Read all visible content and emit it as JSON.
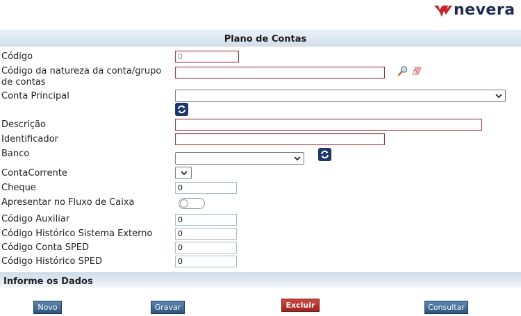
{
  "logo": {
    "text": "nevera",
    "brand_color": "#c8232a",
    "text_color": "#1d2a57"
  },
  "header": {
    "title": "Plano de Contas"
  },
  "form": {
    "codigo": {
      "label": "Código",
      "value": "0"
    },
    "natureza": {
      "label_line1": "Código da natureza da conta/grupo",
      "label_line2": "de contas",
      "value": "",
      "search_icon": "magnifier-icon",
      "clear_icon": "eraser-icon"
    },
    "conta_principal": {
      "label": "Conta Principal",
      "value": ""
    },
    "descricao": {
      "label": "Descrição",
      "value": ""
    },
    "identificador": {
      "label": "Identificador",
      "value": ""
    },
    "banco": {
      "label": "Banco",
      "value": ""
    },
    "conta_corrente": {
      "label": "ContaCorrente",
      "value": ""
    },
    "cheque": {
      "label": "Cheque",
      "value": "0"
    },
    "fluxo_caixa": {
      "label": "Apresentar no Fluxo de Caixa",
      "checked": false
    },
    "codigo_auxiliar": {
      "label": "Código Auxiliar",
      "value": "0"
    },
    "historico_externo": {
      "label": "Código Histórico Sistema Externo",
      "value": "0"
    },
    "conta_sped": {
      "label": "Código Conta SPED",
      "value": "0"
    },
    "historico_sped": {
      "label": "Código Histórico SPED",
      "value": "0"
    }
  },
  "footer": {
    "section_title": "Informe os Dados"
  },
  "buttons": {
    "novo": "Novo",
    "gravar": "Gravar",
    "excluir": "Excluir",
    "consultar": "Consultar"
  },
  "colors": {
    "required_border": "#c8232a",
    "button_blue": "#2d5581",
    "button_red": "#b0241e",
    "header_bg": "#dbe5ef"
  }
}
